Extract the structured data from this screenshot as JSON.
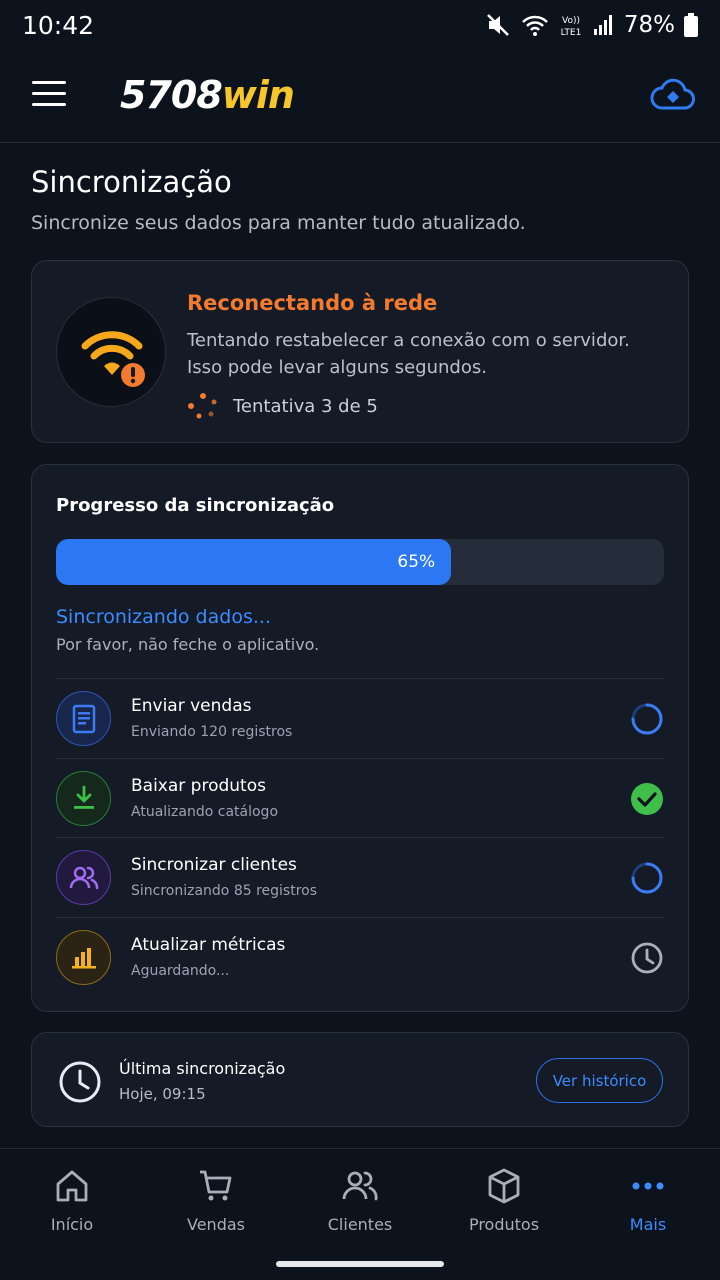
{
  "status_bar": {
    "time": "10:42",
    "battery": "78%",
    "network_label": "Vo)) LTE1"
  },
  "header": {
    "logo_white": "5708",
    "logo_yellow": "win",
    "menu_icon": "hamburger-menu-icon",
    "sync_icon": "cloud-sync-icon"
  },
  "page": {
    "title": "Sincronização",
    "subtitle": "Sincronize seus dados para manter tudo atualizado."
  },
  "reconnect": {
    "title": "Reconectando à rede",
    "line1": "Tentando restabelecer a conexão com o servidor.",
    "line2": "Isso pode levar alguns segundos.",
    "attempt": "Tentativa 3 de 5"
  },
  "progress": {
    "title": "Progresso da sincronização",
    "percent": 65,
    "percent_label": "65%",
    "status": "Sincronizando dados...",
    "note": "Por favor, não feche o aplicativo.",
    "tasks": [
      {
        "title": "Enviar vendas",
        "subtitle": "Enviando 120 registros",
        "icon": "document-icon",
        "state": "in-progress",
        "color": "#3d7cf0"
      },
      {
        "title": "Baixar produtos",
        "subtitle": "Atualizando catálogo",
        "icon": "download-icon",
        "state": "done",
        "color": "#3fbf4a"
      },
      {
        "title": "Sincronizar clientes",
        "subtitle": "Sincronizando 85 registros",
        "icon": "users-icon",
        "state": "in-progress",
        "color": "#a16cf2"
      },
      {
        "title": "Atualizar métricas",
        "subtitle": "Aguardando...",
        "icon": "bar-chart-icon",
        "state": "waiting",
        "color": "#f2b21f"
      }
    ]
  },
  "last_sync": {
    "title": "Última sincronização",
    "time": "Hoje, 09:15",
    "button": "Ver histórico"
  },
  "nav": [
    {
      "label": "Início",
      "icon": "home-icon"
    },
    {
      "label": "Vendas",
      "icon": "cart-icon"
    },
    {
      "label": "Clientes",
      "icon": "users-icon"
    },
    {
      "label": "Produtos",
      "icon": "box-icon"
    },
    {
      "label": "Mais",
      "icon": "more-dots-icon",
      "active": true
    }
  ],
  "colors": {
    "accent": "#3d8bff",
    "warning": "#f37a2e",
    "wifi": "#f6a81c",
    "success": "#3fbf4a"
  }
}
